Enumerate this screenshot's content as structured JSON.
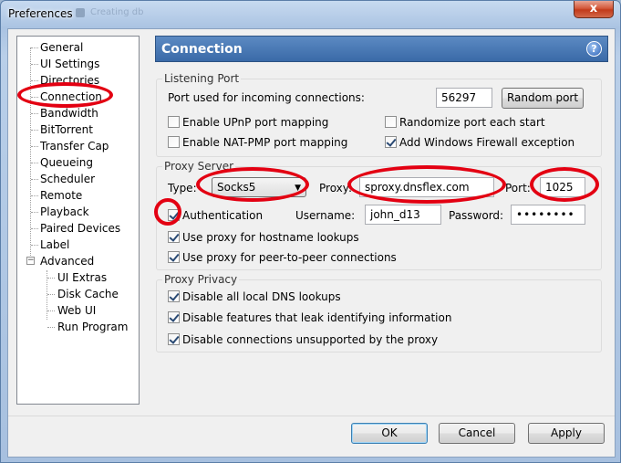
{
  "window": {
    "title": "Preferences",
    "ghost_title": "Creating db",
    "close_glyph": "x"
  },
  "tree": {
    "items": [
      "General",
      "UI Settings",
      "Directories",
      "Connection",
      "Bandwidth",
      "BitTorrent",
      "Transfer Cap",
      "Queueing",
      "Scheduler",
      "Remote",
      "Playback",
      "Paired Devices",
      "Label",
      "Advanced"
    ],
    "children": [
      "UI Extras",
      "Disk Cache",
      "Web UI",
      "Run Program"
    ],
    "expander_glyph": "−"
  },
  "header": {
    "title": "Connection",
    "help_glyph": "?"
  },
  "listening_port": {
    "group_title": "Listening Port",
    "port_label": "Port used for incoming connections:",
    "port_value": "56297",
    "random_button": "Random port",
    "upnp": {
      "label": "Enable UPnP port mapping",
      "checked": false
    },
    "random_each_start": {
      "label": "Randomize port each start",
      "checked": false
    },
    "natpmp": {
      "label": "Enable NAT-PMP port mapping",
      "checked": false
    },
    "firewall": {
      "label": "Add Windows Firewall exception",
      "checked": true
    }
  },
  "proxy_server": {
    "group_title": "Proxy Server",
    "type_label": "Type:",
    "type_value": "Socks5",
    "proxy_label": "Proxy:",
    "proxy_value": "sproxy.dnsflex.com",
    "port_label": "Port:",
    "port_value": "1025",
    "authentication": {
      "label": "Authentication",
      "checked": true
    },
    "username_label": "Username:",
    "username_value": "john_d13",
    "password_label": "Password:",
    "password_value": "••••••••",
    "hostname_lookups": {
      "label": "Use proxy for hostname lookups",
      "checked": true
    },
    "p2p": {
      "label": "Use proxy for peer-to-peer connections",
      "checked": true
    }
  },
  "proxy_privacy": {
    "group_title": "Proxy Privacy",
    "dns": {
      "label": "Disable all local DNS lookups",
      "checked": true
    },
    "leak": {
      "label": "Disable features that leak identifying information",
      "checked": true
    },
    "unsupported": {
      "label": "Disable connections unsupported by the proxy",
      "checked": true
    }
  },
  "buttons": {
    "ok": "OK",
    "cancel": "Cancel",
    "apply": "Apply"
  },
  "annotation_color": "#e30012"
}
